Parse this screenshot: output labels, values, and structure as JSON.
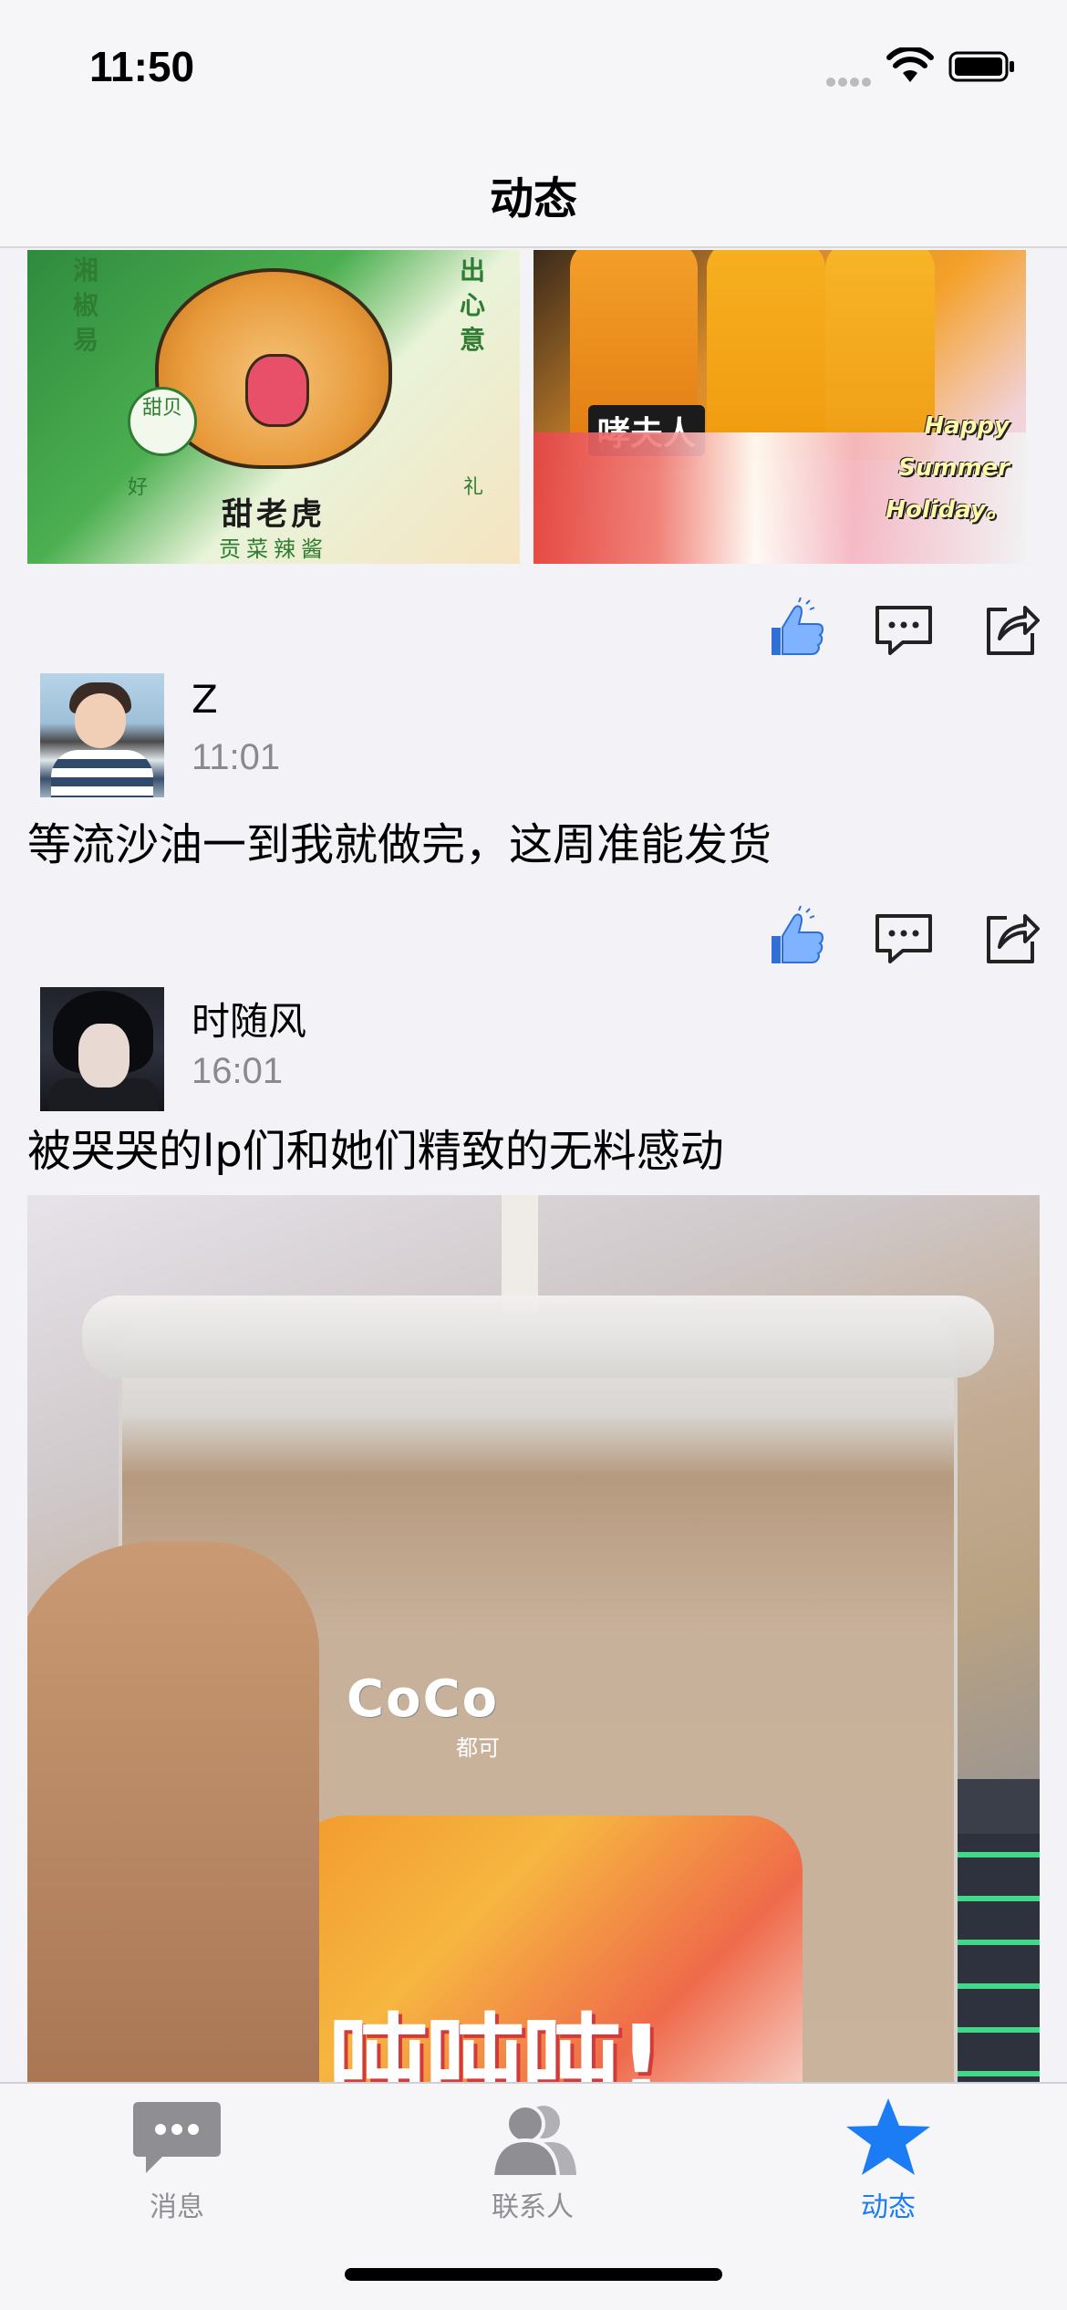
{
  "status_bar": {
    "time": "11:50"
  },
  "nav": {
    "title": "动态"
  },
  "photos": {
    "tiger_pack": {
      "brand": "甜老虎",
      "subtitle": "贡菜辣酱",
      "side_left": "湘椒易",
      "side_right": "出心意",
      "seal": "甜贝",
      "corner_left": "好",
      "corner_right": "礼"
    },
    "snacks": {
      "bottle_label": "哮夫人",
      "caption": [
        "Happy",
        "Summer",
        "Holiday。"
      ]
    },
    "milk_tea": {
      "logo": "CoCo",
      "logo_sub": "都可",
      "sticker_text": "吨吨吨!"
    }
  },
  "posts": [
    {
      "author": "Z",
      "time": "11:01",
      "text": "等流沙油一到我就做完，这周准能发货"
    },
    {
      "author": "时随风",
      "time": "16:01",
      "text": "被哭哭的lp们和她们精致的无料感动"
    }
  ],
  "actions": {
    "like_icon": "thumbs-up-icon",
    "comment_icon": "comment-icon",
    "share_icon": "share-icon"
  },
  "tabs": [
    {
      "label": "消息",
      "icon": "chat-bubble-icon",
      "active": false
    },
    {
      "label": "联系人",
      "icon": "contacts-icon",
      "active": false
    },
    {
      "label": "动态",
      "icon": "star-icon",
      "active": true
    }
  ],
  "colors": {
    "accent": "#1c7cf4",
    "inactive": "#8e8e93",
    "like_blue": "#2f6fd6"
  }
}
